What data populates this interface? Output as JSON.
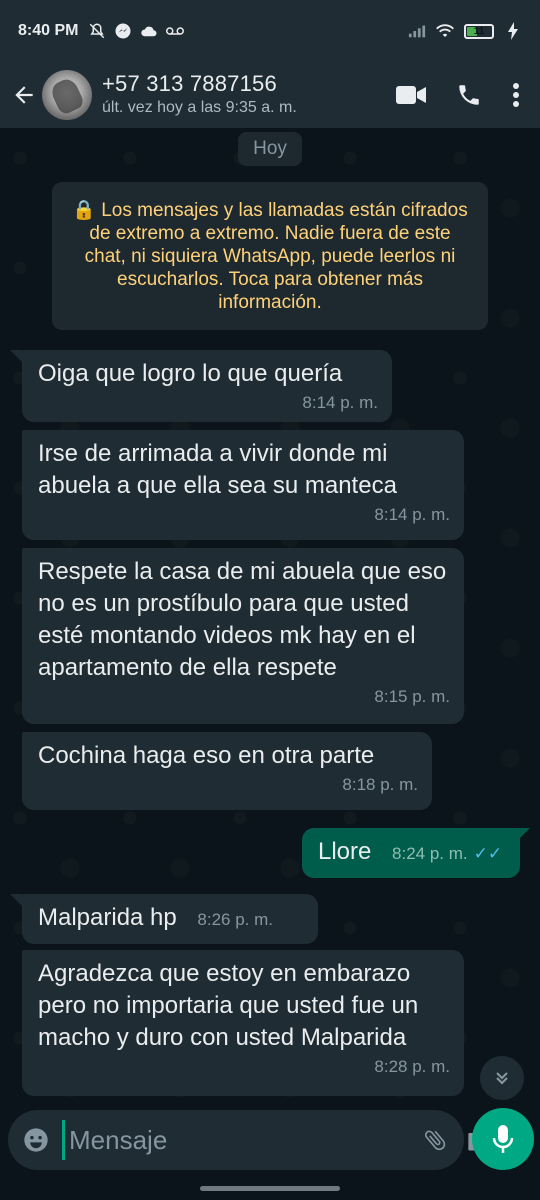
{
  "status_bar": {
    "time": "8:40 PM",
    "battery": "11"
  },
  "header": {
    "contact_name": "+57 313 7887156",
    "last_seen": "últ. vez hoy a las 9:35 a. m."
  },
  "chat": {
    "date_label": "Hoy",
    "encryption_notice": "🔒 Los mensajes y las llamadas están cifrados de extremo a extremo. Nadie fuera de este chat, ni siquiera WhatsApp, puede leerlos ni escucharlos. Toca para obtener más información.",
    "messages": [
      {
        "direction": "in",
        "text": "Oiga que logro lo que quería",
        "time": "8:14 p. m."
      },
      {
        "direction": "in",
        "text": "Irse de arrimada a vivir donde mi abuela  a que ella sea su manteca",
        "time": "8:14 p. m."
      },
      {
        "direction": "in",
        "text": "Respete la casa de mi abuela que eso no es un prostíbulo para que usted esté montando videos mk hay en el apartamento de ella respete",
        "time": "8:15 p. m."
      },
      {
        "direction": "in",
        "text": "Cochina haga eso en otra parte",
        "time": "8:18 p. m."
      },
      {
        "direction": "out",
        "text": "Llore",
        "time": "8:24 p. m.",
        "status": "read"
      },
      {
        "direction": "in",
        "text": "Malparida hp",
        "time": "8:26 p. m."
      },
      {
        "direction": "in",
        "text": "Agradezca que estoy en embarazo pero no importaria que usted fue un macho y duro con usted Malparida",
        "time": "8:28 p. m."
      }
    ]
  },
  "input": {
    "placeholder": "Mensaje"
  },
  "colors": {
    "background": "#0b141a",
    "bar": "#1f2c34",
    "incoming_bubble": "#202c33",
    "outgoing_bubble": "#005c4b",
    "accent": "#00a884",
    "encryption_text": "#ffd279",
    "read_ticks": "#53bdeb"
  },
  "icons": [
    "back-arrow-icon",
    "video-call-icon",
    "phone-icon",
    "more-options-icon",
    "emoji-icon",
    "attach-icon",
    "camera-icon",
    "mic-icon",
    "scroll-down-icon"
  ]
}
